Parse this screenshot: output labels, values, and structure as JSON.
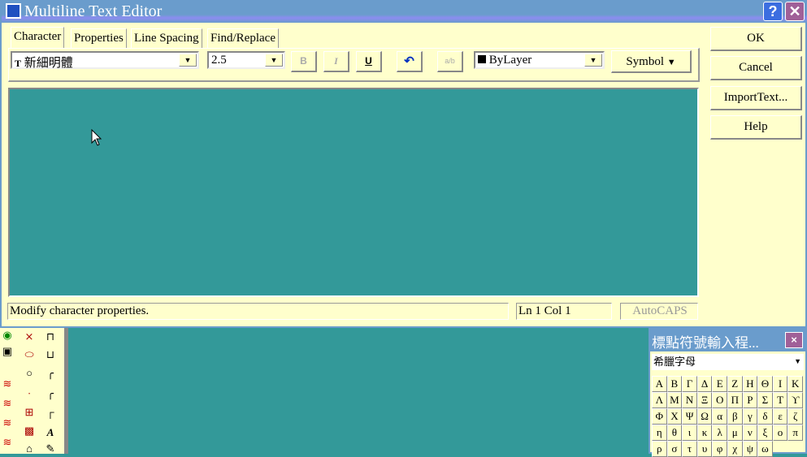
{
  "window": {
    "title": "Multiline Text Editor",
    "help": "?",
    "close": "✕"
  },
  "tabs": [
    {
      "label": "Character"
    },
    {
      "label": "Properties"
    },
    {
      "label": "Line Spacing"
    },
    {
      "label": "Find/Replace"
    }
  ],
  "toolbar": {
    "font": "新細明體",
    "font_icon": "T",
    "height": "2.5",
    "bold": "B",
    "italic": "I",
    "underline": "U",
    "undo": "↶",
    "stack": "a/b",
    "color": "ByLayer",
    "symbol": "Symbol"
  },
  "buttons": {
    "ok": "OK",
    "cancel": "Cancel",
    "import": "ImportText...",
    "help": "Help"
  },
  "status": {
    "message": "Modify character properties.",
    "position": "Ln 1 Col 1",
    "autocaps": "AutoCAPS"
  },
  "palette": {
    "title": "標點符號輸入程...",
    "close": "×",
    "category": "希臘字母",
    "symbols": [
      "Α",
      "Β",
      "Γ",
      "Δ",
      "Ε",
      "Ζ",
      "Η",
      "Θ",
      "Ι",
      "Κ",
      "Λ",
      "Μ",
      "Ν",
      "Ξ",
      "Ο",
      "Π",
      "Ρ",
      "Σ",
      "Τ",
      "ϒ",
      "Φ",
      "Χ",
      "Ψ",
      "Ω",
      "α",
      "β",
      "γ",
      "δ",
      "ε",
      "ζ",
      "η",
      "θ",
      "ι",
      "κ",
      "λ",
      "μ",
      "ν",
      "ξ",
      "ο",
      "π",
      "ρ",
      "σ",
      "τ",
      "υ",
      "φ",
      "χ",
      "ψ",
      "ω"
    ]
  }
}
